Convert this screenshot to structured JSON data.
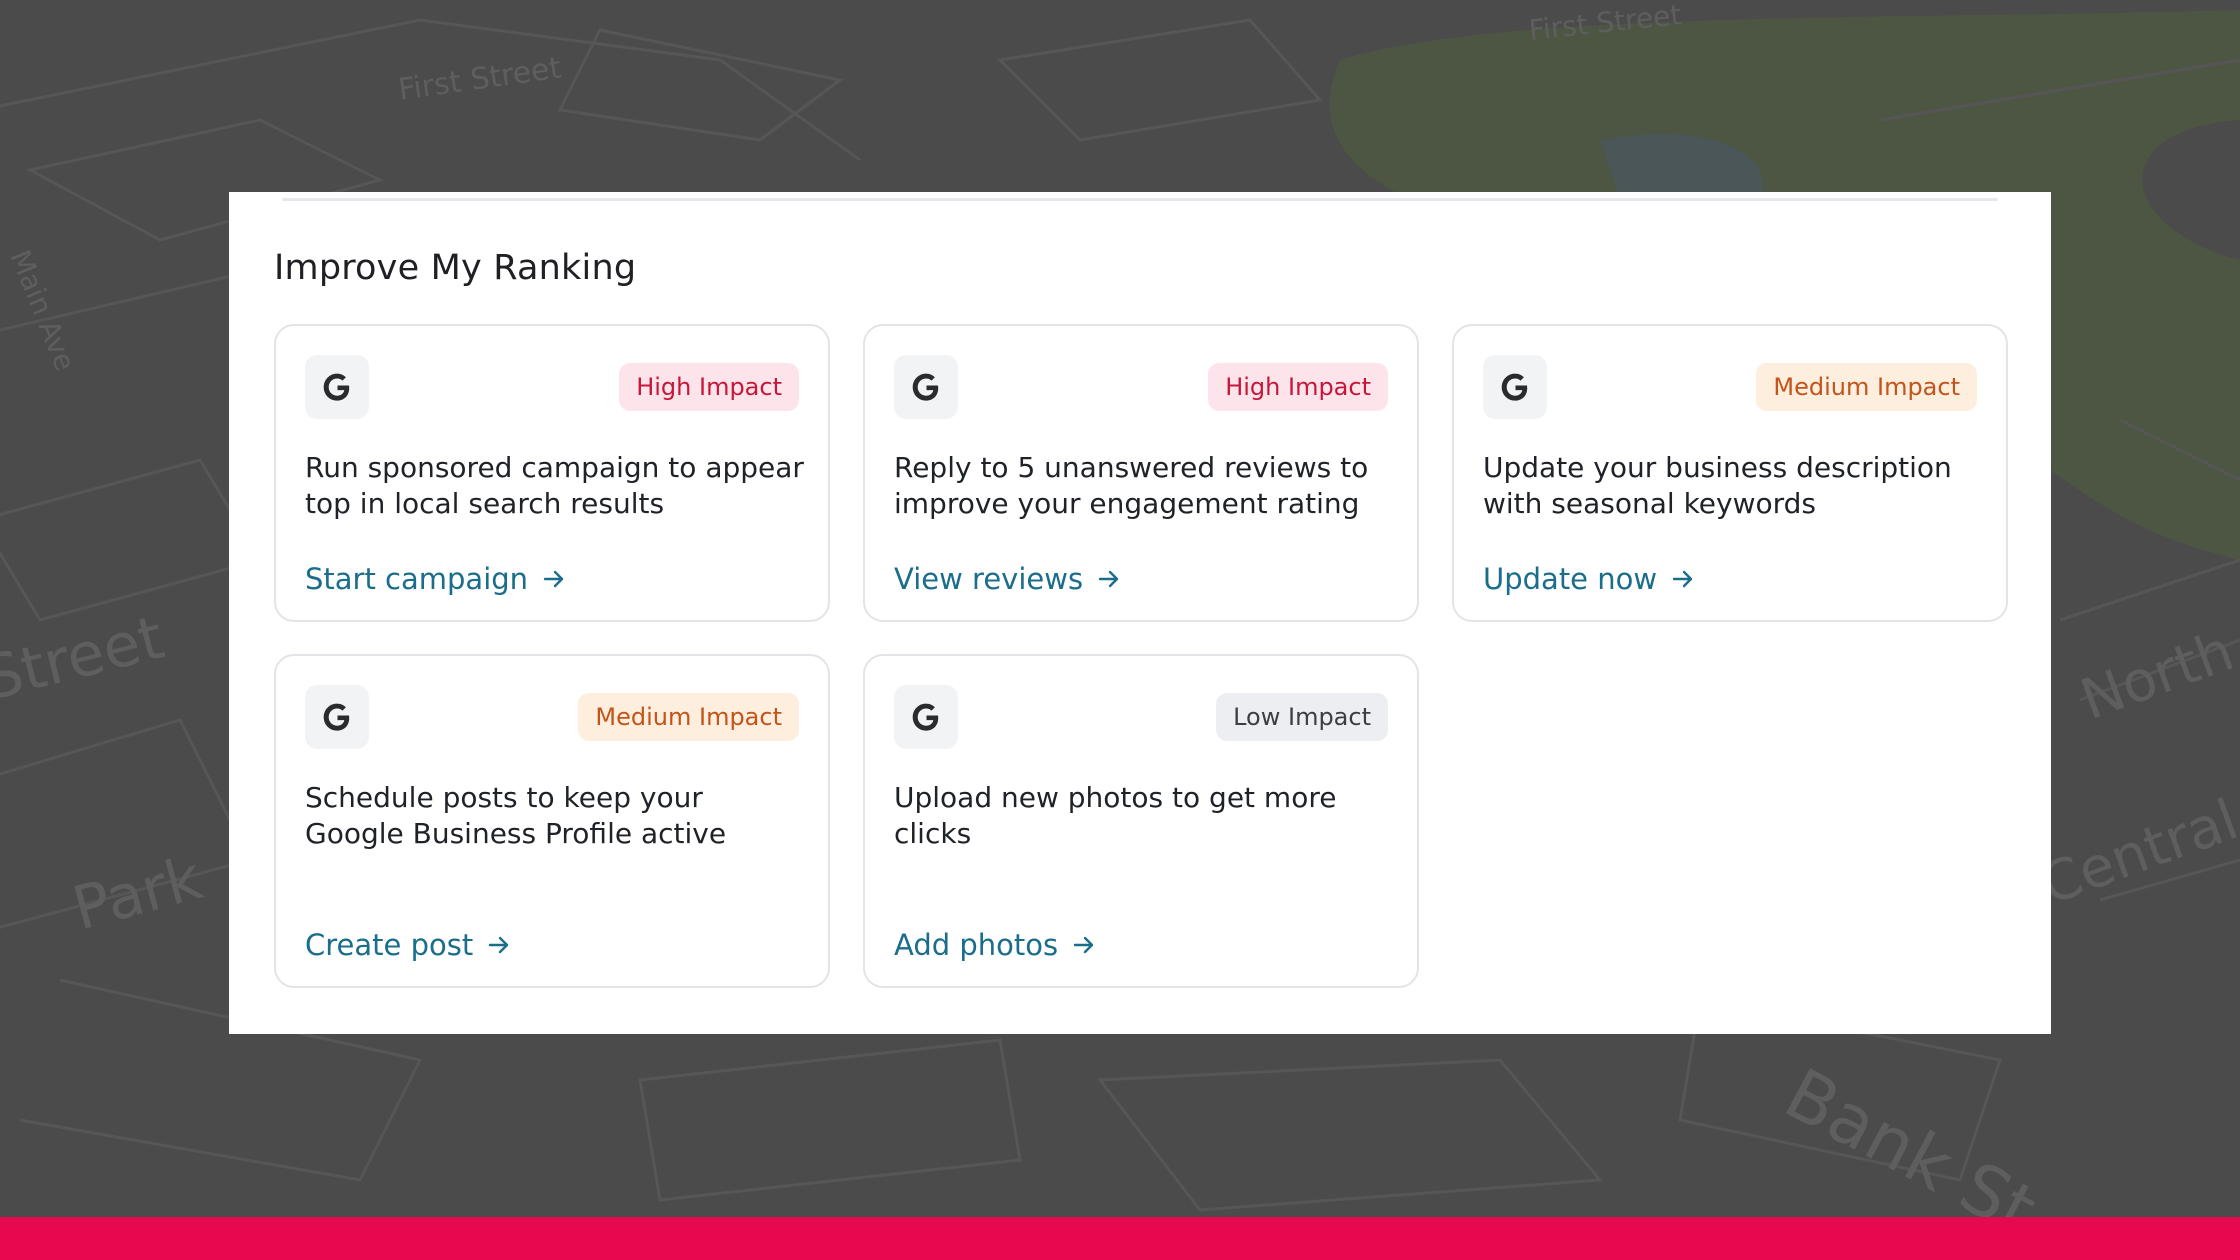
{
  "section_title": "Improve My Ranking",
  "map_labels": [
    "First Street",
    "First Street",
    "Bank Street",
    "Main Ave",
    "Park",
    "North",
    "Central",
    "Street"
  ],
  "colors": {
    "accent_link": "#1b6d8c",
    "bottom_bar": "#e8084f",
    "high": "#c6173b",
    "medium": "#c2541c",
    "low": "#3b3f45"
  },
  "cards": [
    {
      "icon": "google-g-icon",
      "impact": "High Impact",
      "impact_level": "high",
      "text": "Run sponsored campaign to appear top in local search results",
      "action": "Start campaign"
    },
    {
      "icon": "google-g-icon",
      "impact": "High Impact",
      "impact_level": "high",
      "text": "Reply to 5 unanswered reviews to improve your engagement rating",
      "action": "View reviews"
    },
    {
      "icon": "google-g-icon",
      "impact": "Medium Impact",
      "impact_level": "medium",
      "text": "Update your business description with seasonal keywords",
      "action": "Update now"
    },
    {
      "icon": "google-g-icon",
      "impact": "Medium Impact",
      "impact_level": "medium",
      "text": "Schedule posts to keep your Google Business Profile active",
      "action": "Create post"
    },
    {
      "icon": "google-g-icon",
      "impact": "Low Impact",
      "impact_level": "low",
      "text": "Upload new photos to get more clicks",
      "action": "Add photos"
    }
  ]
}
